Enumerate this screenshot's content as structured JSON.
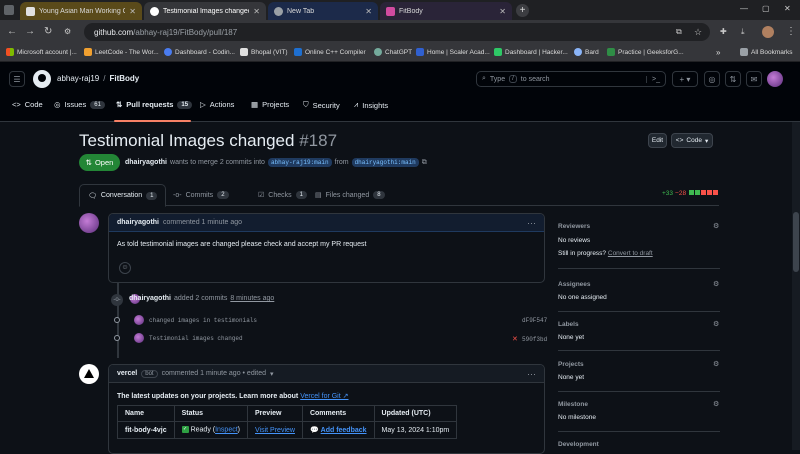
{
  "browser": {
    "tabs": [
      {
        "label": "Young Asian Man Working Ou",
        "active": false
      },
      {
        "label": "Testimonial Images changed by",
        "active": true
      },
      {
        "label": "New Tab",
        "active": false
      },
      {
        "label": "FitBody",
        "active": false
      }
    ],
    "new_tab": "+",
    "url_host": "github.com",
    "url_path": "/abhay-raj19/FitBody/pull/187",
    "bookmarks": [
      "Microsoft account |...",
      "LeetCode - The Wor...",
      "Dashboard - Codin...",
      "Bhopal (VIT)",
      "Online C++ Compiler",
      "ChatGPT",
      "Home | Scaler Acad...",
      "Dashboard | Hacker...",
      "Bard",
      "Practice | GeeksforG...",
      "All Bookmarks"
    ],
    "bookmarks_more": "»"
  },
  "github": {
    "owner": "abhay-raj19",
    "sep": "/",
    "repo": "FitBody",
    "search_placeholder": "Type / to search",
    "search_prefix": "Type",
    "search_key": "/",
    "search_suffix": "to search",
    "repo_tabs": [
      {
        "label": "Code",
        "count": null
      },
      {
        "label": "Issues",
        "count": "61"
      },
      {
        "label": "Pull requests",
        "count": "15"
      },
      {
        "label": "Actions",
        "count": null
      },
      {
        "label": "Projects",
        "count": null
      },
      {
        "label": "Security",
        "count": null
      },
      {
        "label": "Insights",
        "count": null
      }
    ]
  },
  "pr": {
    "title": "Testimonial Images changed",
    "number": "#187",
    "edit_label": "Edit",
    "code_label": "Code",
    "state": "Open",
    "author": "dhairyagothi",
    "merge_text": "wants to merge 2 commits into",
    "base_branch": "abhay-raj19:main",
    "from_text": "from",
    "head_branch": "dhairyagothi:main",
    "tabs": [
      {
        "label": "Conversation",
        "count": "1"
      },
      {
        "label": "Commits",
        "count": "2"
      },
      {
        "label": "Checks",
        "count": "1"
      },
      {
        "label": "Files changed",
        "count": "8"
      }
    ],
    "additions": "+33",
    "deletions": "−28"
  },
  "comment1": {
    "author": "dhairyagothi",
    "meta": "commented 1 minute ago",
    "body": "As told testimonial images are changed please check and accept my PR request",
    "menu": "···"
  },
  "commits_event": {
    "author": "dhairyagothi",
    "text": "added 2 commits",
    "time": "8 minutes ago",
    "commits": [
      {
        "message": "changed images in testimonials",
        "sha": "dF9F547",
        "status": "none"
      },
      {
        "message": "Testimonial images changed",
        "sha": "590f3bd",
        "status": "fail"
      }
    ]
  },
  "comment2": {
    "author": "vercel",
    "badge": "bot",
    "meta": "commented 1 minute ago • edited",
    "menu": "···",
    "intro": "The latest updates on your projects. Learn more about",
    "intro_link": "Vercel for Git ↗",
    "table": {
      "headers": [
        "Name",
        "Status",
        "Preview",
        "Comments",
        "Updated (UTC)"
      ],
      "row": {
        "name": "fit-body-4vjc",
        "status": "Ready",
        "status_link": "Inspect",
        "preview": "Visit Preview",
        "comments": "Add feedback",
        "updated": "May 13, 2024 1:10pm"
      }
    }
  },
  "sidebar": {
    "reviewers_title": "Reviewers",
    "reviewers_value": "No reviews",
    "in_progress": "Still in progress?",
    "convert_link": "Convert to draft",
    "assignees_title": "Assignees",
    "assignees_value": "No one assigned",
    "labels_title": "Labels",
    "labels_value": "None yet",
    "projects_title": "Projects",
    "projects_value": "None yet",
    "milestone_title": "Milestone",
    "milestone_value": "No milestone",
    "development_title": "Development"
  },
  "colors": {
    "bg": "#0d1117",
    "header_bg": "#010409",
    "border": "#30363d",
    "open_green": "#238636",
    "link_blue": "#4493f8",
    "add_green": "#3fb950",
    "del_red": "#f85149"
  }
}
